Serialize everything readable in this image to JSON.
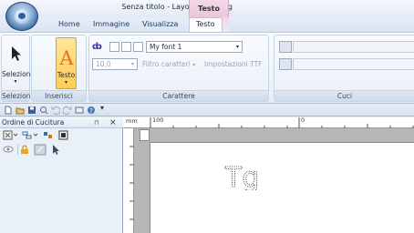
{
  "window": {
    "title": "Senza titolo - Layout & Editing",
    "context_tab": "Testo"
  },
  "tabs": [
    {
      "label": "Home"
    },
    {
      "label": "Immagine"
    },
    {
      "label": "Visualizza"
    },
    {
      "label": "Testo",
      "active": true
    }
  ],
  "ribbon": {
    "groups": {
      "seleziona": "Seleziona",
      "inserisci": "Inserisci",
      "carattere": "Carattere",
      "cuci": "Cuci"
    },
    "seleziona_button": "Seleziona",
    "testo_button": "Testo",
    "font_name": "My font 1",
    "font_size": "10,0",
    "filtro_caratteri": "Filtro caratteri",
    "impostazioni_ttf": "Impostazioni TTF"
  },
  "pane": {
    "title": "Ordine di Cucitura",
    "pin_glyph": "⊓",
    "close_glyph": "×"
  },
  "ruler": {
    "corner": "mm",
    "mark_100": "100",
    "mark_0": "0"
  },
  "canvas": {
    "text": "Tg"
  },
  "colors": {
    "accent": "#ffcc55",
    "context_tab": "#ecc4dc",
    "letter": "#ff8a00"
  }
}
